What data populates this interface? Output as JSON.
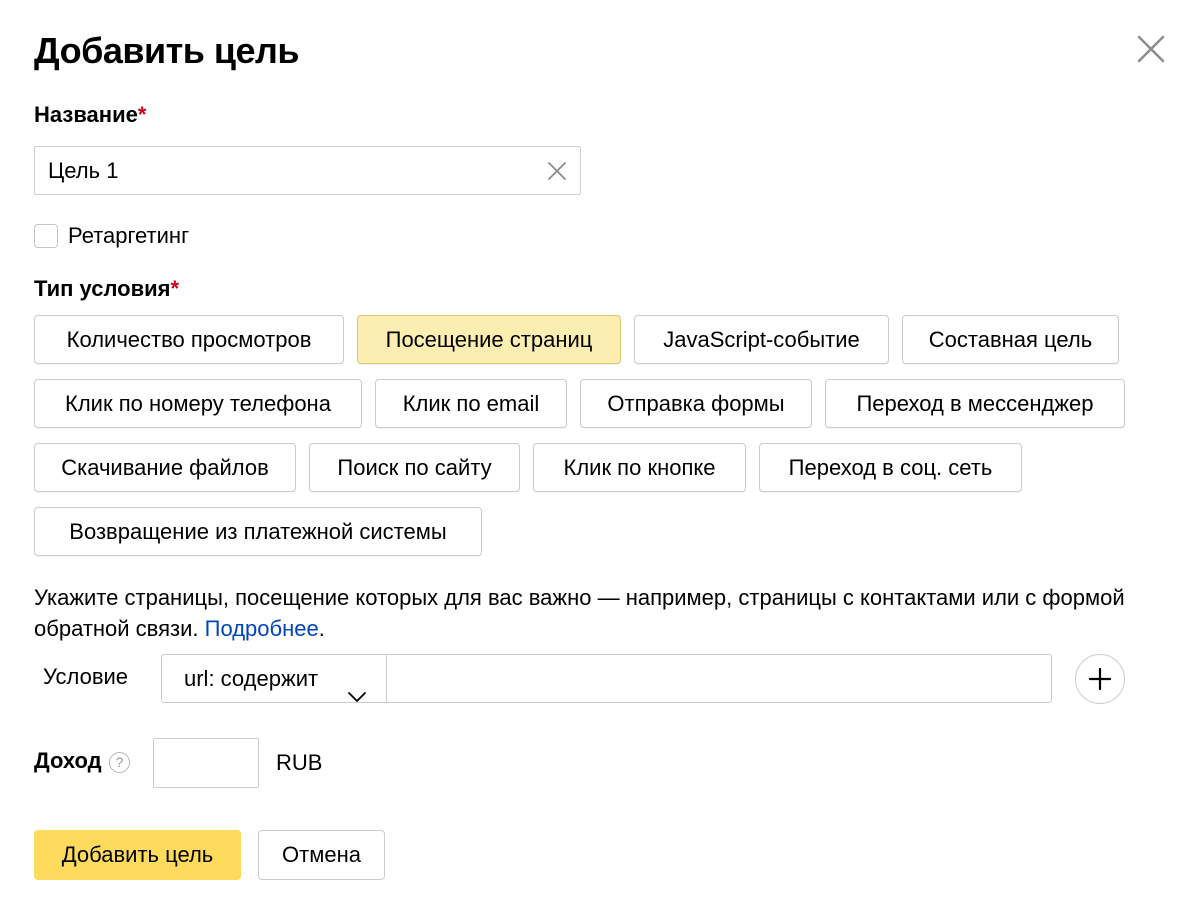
{
  "dialog": {
    "title": "Добавить цель",
    "close_icon": "close-icon"
  },
  "name_field": {
    "label": "Название",
    "required_mark": "*",
    "value": "Цель 1",
    "clear_icon": "clear-x-icon"
  },
  "retargeting": {
    "label": "Ретаргетинг",
    "checked": false
  },
  "condition_type": {
    "label": "Тип условия",
    "required_mark": "*",
    "selected": "Посещение страниц",
    "rows": [
      [
        "Количество просмотров",
        "Посещение страниц",
        "JavaScript-событие",
        "Составная цель"
      ],
      [
        "Клик по номеру телефона",
        "Клик по email",
        "Отправка формы",
        "Переход в мессенджер"
      ],
      [
        "Скачивание файлов",
        "Поиск по сайту",
        "Клик по кнопке",
        "Переход в соц. сеть"
      ],
      [
        "Возвращение из платежной системы"
      ]
    ]
  },
  "hint": {
    "text": "Укажите страницы, посещение которых для вас важно — например, страницы с контактами или с формой обратной связи. ",
    "link": "Подробнее",
    "suffix": "."
  },
  "condition": {
    "label": "Условие",
    "operator": "url: содержит",
    "value": "",
    "add_icon": "plus-icon"
  },
  "income": {
    "label": "Доход",
    "help_glyph": "?",
    "value": "",
    "currency": "RUB"
  },
  "buttons": {
    "submit": "Добавить цель",
    "cancel": "Отмена"
  },
  "colors": {
    "accent_yellow": "#fedb5c",
    "selected_chip": "#fceeb0",
    "required_red": "#d0021b",
    "link_blue": "#0044bb"
  }
}
